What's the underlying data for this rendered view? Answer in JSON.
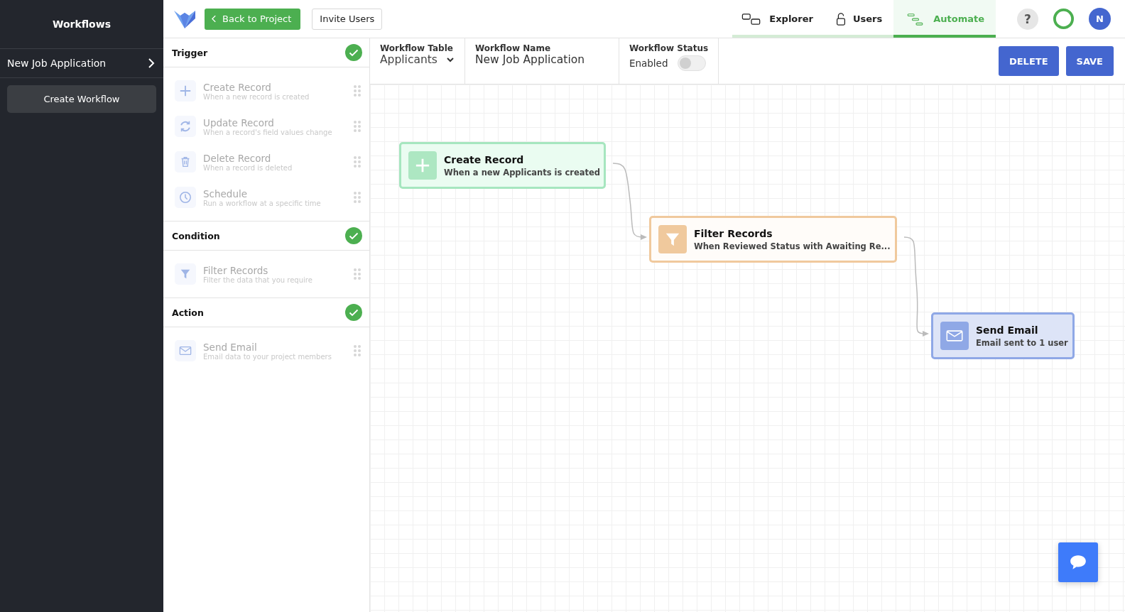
{
  "sidebar": {
    "title": "Workflows",
    "items": [
      {
        "label": "New Job Application",
        "selected": true
      }
    ],
    "create_button": "Create Workflow"
  },
  "header": {
    "back_button": "Back to Project",
    "invite_button": "Invite Users",
    "tabs": [
      {
        "label": "Explorer",
        "kind": "explorer",
        "selected": false
      },
      {
        "label": "Users",
        "kind": "users",
        "selected": false
      },
      {
        "label": "Automate",
        "kind": "automate",
        "selected": true
      }
    ],
    "help": "?",
    "avatar": "N"
  },
  "palette": [
    {
      "title": "Trigger",
      "done": true,
      "items": [
        {
          "kind": "create",
          "title": "Create Record",
          "subtitle": "When a new record is created"
        },
        {
          "kind": "update",
          "title": "Update Record",
          "subtitle": "When a record's field values change"
        },
        {
          "kind": "delete",
          "title": "Delete Record",
          "subtitle": "When a record is deleted"
        },
        {
          "kind": "schedule",
          "title": "Schedule",
          "subtitle": "Run a workflow at a specific time"
        }
      ]
    },
    {
      "title": "Condition",
      "done": true,
      "items": [
        {
          "kind": "filter",
          "title": "Filter Records",
          "subtitle": "Filter the data that you require"
        }
      ]
    },
    {
      "title": "Action",
      "done": true,
      "items": [
        {
          "kind": "email",
          "title": "Send Email",
          "subtitle": "Email data to your project members"
        }
      ]
    }
  ],
  "toolbar": {
    "table": {
      "label": "Workflow Table",
      "value": "Applicants"
    },
    "name": {
      "label": "Workflow Name",
      "value": "New Job Application"
    },
    "status": {
      "label": "Workflow Status",
      "value": "Enabled",
      "on": false
    },
    "delete_button": "DELETE",
    "save_button": "SAVE"
  },
  "nodes": [
    {
      "kind": "trigger",
      "title": "Create Record",
      "subtitle": "When a new Applicants is created"
    },
    {
      "kind": "condition",
      "title": "Filter Records",
      "subtitle": "When Reviewed Status with Awaiting Re..."
    },
    {
      "kind": "action",
      "title": "Send Email",
      "subtitle": "Email sent to 1 user"
    }
  ]
}
